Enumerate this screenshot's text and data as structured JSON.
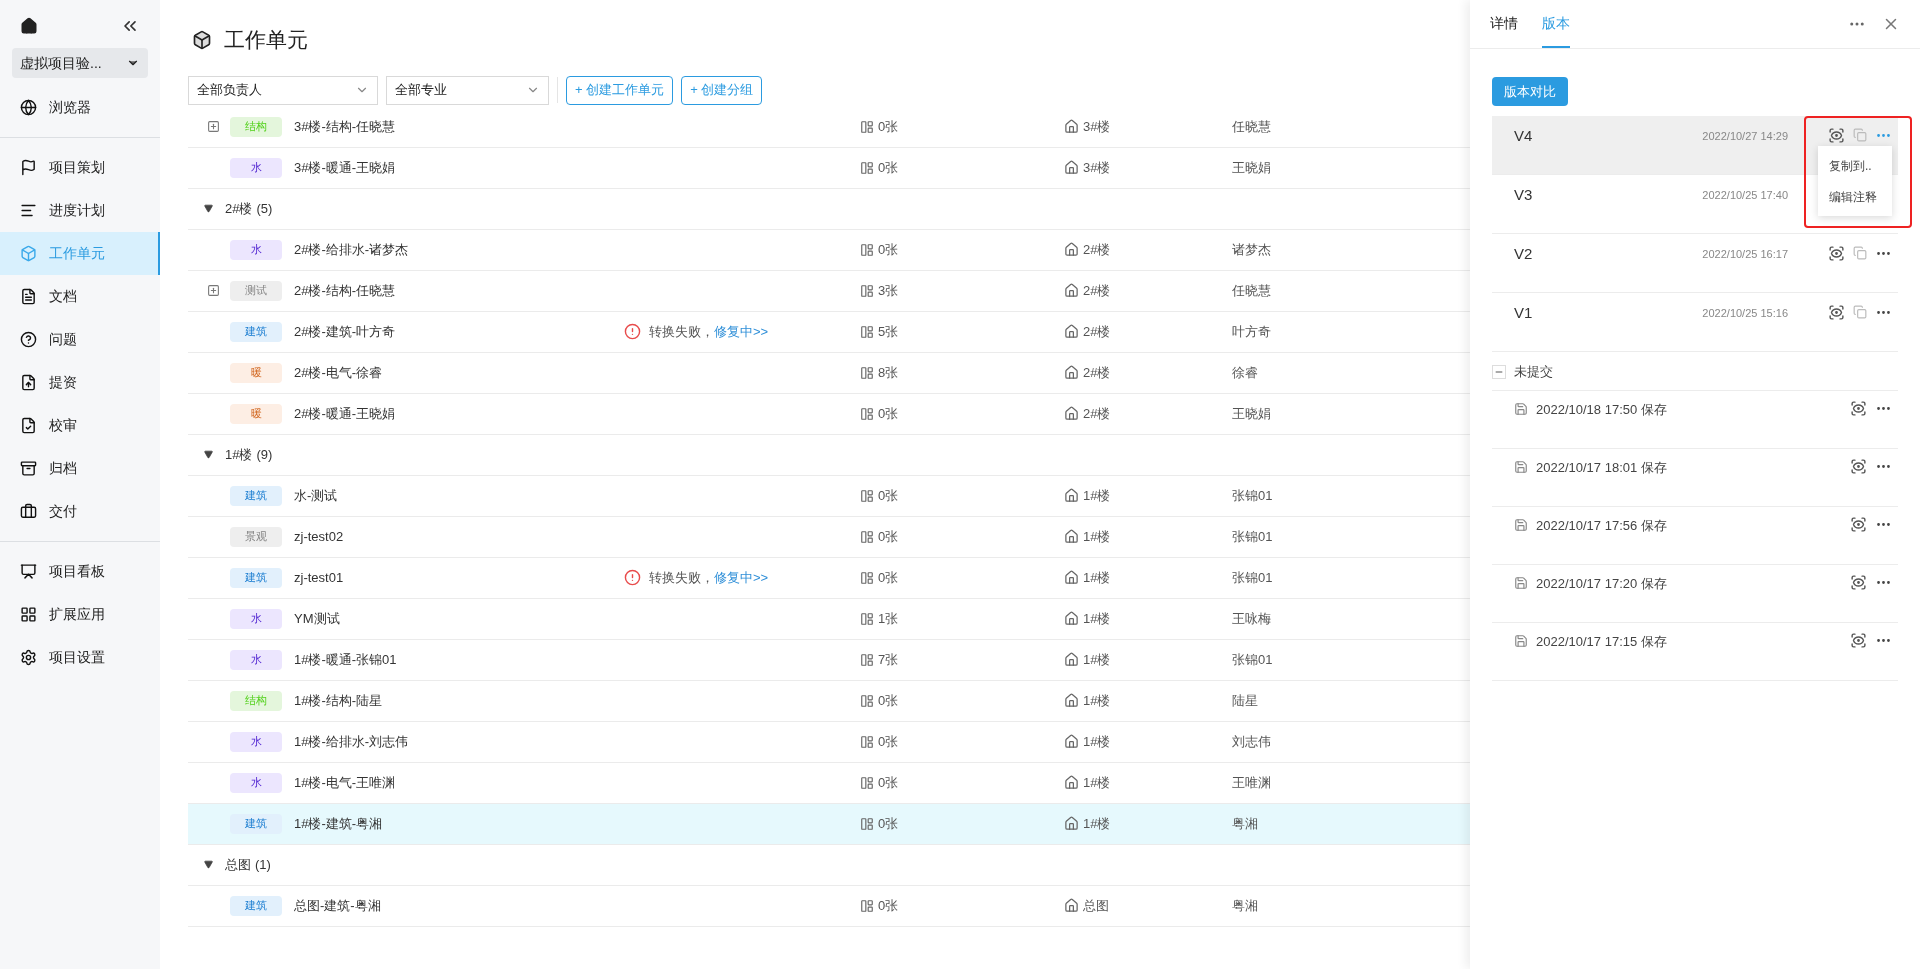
{
  "sidebar": {
    "project": "虚拟项目验...",
    "sections": [
      {
        "items": [
          {
            "label": "浏览器",
            "selected": false
          }
        ]
      },
      {
        "items": [
          {
            "label": "项目策划",
            "selected": false
          },
          {
            "label": "进度计划",
            "selected": false
          },
          {
            "label": "工作单元",
            "selected": true
          },
          {
            "label": "文档",
            "selected": false
          },
          {
            "label": "问题",
            "selected": false
          },
          {
            "label": "提资",
            "selected": false
          },
          {
            "label": "校审",
            "selected": false
          },
          {
            "label": "归档",
            "selected": false
          },
          {
            "label": "交付",
            "selected": false
          }
        ]
      },
      {
        "items": [
          {
            "label": "项目看板",
            "selected": false
          },
          {
            "label": "扩展应用",
            "selected": false
          },
          {
            "label": "项目设置",
            "selected": false
          }
        ]
      }
    ]
  },
  "page": {
    "title": "工作单元"
  },
  "filters": [
    {
      "value": "全部负责人"
    },
    {
      "value": "全部专业"
    }
  ],
  "actions": [
    "+ 创建工作单元",
    "+ 创建分组"
  ],
  "rows": [
    {
      "kind": "unit",
      "expandable": true,
      "selected": false,
      "tag": {
        "label": "结构",
        "color": "#e4f6dc"
      },
      "name": "3#楼-结构-任晓慧",
      "sheets": "0张",
      "floor": "3#楼",
      "owner": "任晓慧"
    },
    {
      "kind": "unit",
      "expandable": false,
      "selected": false,
      "tag": {
        "label": "水",
        "color": "#ece6fe"
      },
      "name": "3#楼-暖通-王晓娟",
      "sheets": "0张",
      "floor": "3#楼",
      "owner": "王晓娟"
    },
    {
      "kind": "group",
      "expanded": true,
      "label": "2#楼",
      "count": "(5)"
    },
    {
      "kind": "unit",
      "expandable": false,
      "selected": false,
      "tag": {
        "label": "水",
        "color": "#ece6fe"
      },
      "name": "2#楼-给排水-诸梦杰",
      "sheets": "0张",
      "floor": "2#楼",
      "owner": "诸梦杰"
    },
    {
      "kind": "unit",
      "expandable": true,
      "selected": false,
      "tag": {
        "label": "测试",
        "color": "#eeeeee"
      },
      "name": "2#楼-结构-任晓慧",
      "sheets": "3张",
      "floor": "2#楼",
      "owner": "任晓慧"
    },
    {
      "kind": "unit",
      "expandable": false,
      "selected": false,
      "tag": {
        "label": "建筑",
        "color": "#e2f0fc"
      },
      "name": "2#楼-建筑-叶方奇",
      "error": {
        "text": "转换失败，",
        "link": "修复中>>"
      },
      "sheets": "5张",
      "floor": "2#楼",
      "owner": "叶方奇"
    },
    {
      "kind": "unit",
      "expandable": false,
      "selected": false,
      "tag": {
        "label": "暖",
        "color": "#fdeee4"
      },
      "name": "2#楼-电气-徐睿",
      "sheets": "8张",
      "floor": "2#楼",
      "owner": "徐睿"
    },
    {
      "kind": "unit",
      "expandable": false,
      "selected": false,
      "tag": {
        "label": "暖",
        "color": "#fdeee4"
      },
      "name": "2#楼-暖通-王晓娟",
      "sheets": "0张",
      "floor": "2#楼",
      "owner": "王晓娟"
    },
    {
      "kind": "group",
      "expanded": true,
      "label": "1#楼",
      "count": "(9)"
    },
    {
      "kind": "unit",
      "expandable": false,
      "selected": false,
      "tag": {
        "label": "建筑",
        "color": "#e2f0fc"
      },
      "name": "水-测试",
      "sheets": "0张",
      "floor": "1#楼",
      "owner": "张锦01"
    },
    {
      "kind": "unit",
      "expandable": false,
      "selected": false,
      "tag": {
        "label": "景观",
        "color": "#eeeeee"
      },
      "name": "zj-test02",
      "sheets": "0张",
      "floor": "1#楼",
      "owner": "张锦01"
    },
    {
      "kind": "unit",
      "expandable": false,
      "selected": false,
      "tag": {
        "label": "建筑",
        "color": "#e2f0fc"
      },
      "name": "zj-test01",
      "error": {
        "text": "转换失败，",
        "link": "修复中>>"
      },
      "sheets": "0张",
      "floor": "1#楼",
      "owner": "张锦01"
    },
    {
      "kind": "unit",
      "expandable": false,
      "selected": false,
      "tag": {
        "label": "水",
        "color": "#ece6fe"
      },
      "name": "YM测试",
      "sheets": "1张",
      "floor": "1#楼",
      "owner": "王咏梅"
    },
    {
      "kind": "unit",
      "expandable": false,
      "selected": false,
      "tag": {
        "label": "水",
        "color": "#ece6fe"
      },
      "name": "1#楼-暖通-张锦01",
      "sheets": "7张",
      "floor": "1#楼",
      "owner": "张锦01"
    },
    {
      "kind": "unit",
      "expandable": false,
      "selected": false,
      "tag": {
        "label": "结构",
        "color": "#e4f6dc"
      },
      "name": "1#楼-结构-陆星",
      "sheets": "0张",
      "floor": "1#楼",
      "owner": "陆星"
    },
    {
      "kind": "unit",
      "expandable": false,
      "selected": false,
      "tag": {
        "label": "水",
        "color": "#ece6fe"
      },
      "name": "1#楼-给排水-刘志伟",
      "sheets": "0张",
      "floor": "1#楼",
      "owner": "刘志伟"
    },
    {
      "kind": "unit",
      "expandable": false,
      "selected": false,
      "tag": {
        "label": "水",
        "color": "#ece6fe"
      },
      "name": "1#楼-电气-王唯渊",
      "sheets": "0张",
      "floor": "1#楼",
      "owner": "王唯渊"
    },
    {
      "kind": "unit",
      "expandable": false,
      "selected": true,
      "tag": {
        "label": "建筑",
        "color": "#e2f0fc"
      },
      "name": "1#楼-建筑-粤湘",
      "sheets": "0张",
      "floor": "1#楼",
      "owner": "粤湘"
    },
    {
      "kind": "group",
      "expanded": true,
      "label": "总图",
      "count": "(1)"
    },
    {
      "kind": "unit",
      "expandable": false,
      "selected": false,
      "tag": {
        "label": "建筑",
        "color": "#e2f0fc"
      },
      "name": "总图-建筑-粤湘",
      "sheets": "0张",
      "floor": "总图",
      "owner": "粤湘"
    }
  ],
  "panel": {
    "tabs": [
      {
        "label": "详情",
        "selected": false
      },
      {
        "label": "版本",
        "selected": true
      }
    ],
    "compare_button": "版本对比",
    "versions": [
      {
        "label": "V4",
        "time": "2022/10/27 14:29",
        "selected": true,
        "menu": [
          "复制到..",
          "编辑注释"
        ]
      },
      {
        "label": "V3",
        "time": "2022/10/25 17:40",
        "selected": false
      },
      {
        "label": "V2",
        "time": "2022/10/25 16:17",
        "selected": false
      },
      {
        "label": "V1",
        "time": "2022/10/25 15:16",
        "selected": false
      }
    ],
    "uncommitted": {
      "label": "未提交",
      "expanded": true,
      "items": [
        {
          "text": "2022/10/18 17:50 保存"
        },
        {
          "text": "2022/10/17 18:01 保存"
        },
        {
          "text": "2022/10/17 17:56 保存"
        },
        {
          "text": "2022/10/17 17:20 保存"
        },
        {
          "text": "2022/10/17 17:15 保存"
        }
      ]
    }
  }
}
